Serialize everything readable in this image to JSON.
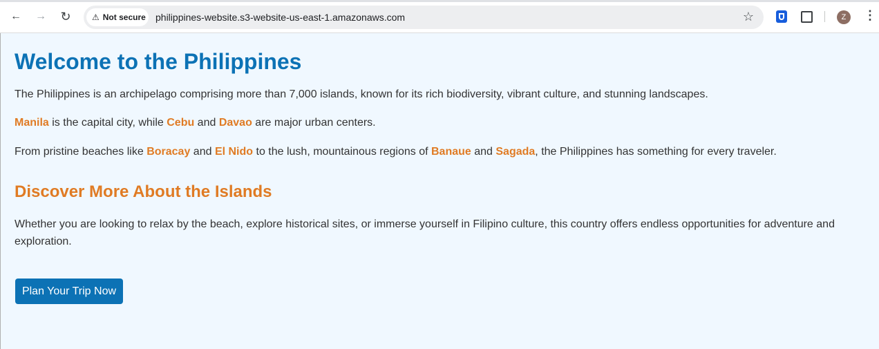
{
  "browser": {
    "security_chip": "Not secure",
    "url": "philippines-website.s3-website-us-east-1.amazonaws.com",
    "avatar_letter": "Z"
  },
  "page": {
    "title": "Welcome to the Philippines",
    "intro": "The Philippines is an archipelago comprising more than 7,000 islands, known for its rich biodiversity, vibrant culture, and stunning landscapes.",
    "cities": {
      "c1": "Manila",
      "t1": " is the capital city, while ",
      "c2": "Cebu",
      "t2": " and ",
      "c3": "Davao",
      "t3": " are major urban centers."
    },
    "places": {
      "t0": "From pristine beaches like ",
      "p1": "Boracay",
      "t1": " and ",
      "p2": "El Nido",
      "t2": " to the lush, mountainous regions of ",
      "p3": "Banaue",
      "t3": " and ",
      "p4": "Sagada",
      "t4": ", the Philippines has something for every traveler."
    },
    "subheading": "Discover More About the Islands",
    "discover_text": "Whether you are looking to relax by the beach, explore historical sites, or immerse yourself in Filipino culture, this country offers endless opportunities for adventure and exploration.",
    "cta_label": "Plan Your Trip Now"
  },
  "colors": {
    "heading_blue": "#0c72b5",
    "highlight_orange": "#e07b24",
    "page_background": "#f0f8ff"
  },
  "icons": [
    "back-arrow-icon",
    "forward-arrow-icon",
    "reload-icon",
    "warning-icon",
    "star-icon",
    "bitwarden-icon",
    "puzzle-icon",
    "more-vert-icon"
  ]
}
